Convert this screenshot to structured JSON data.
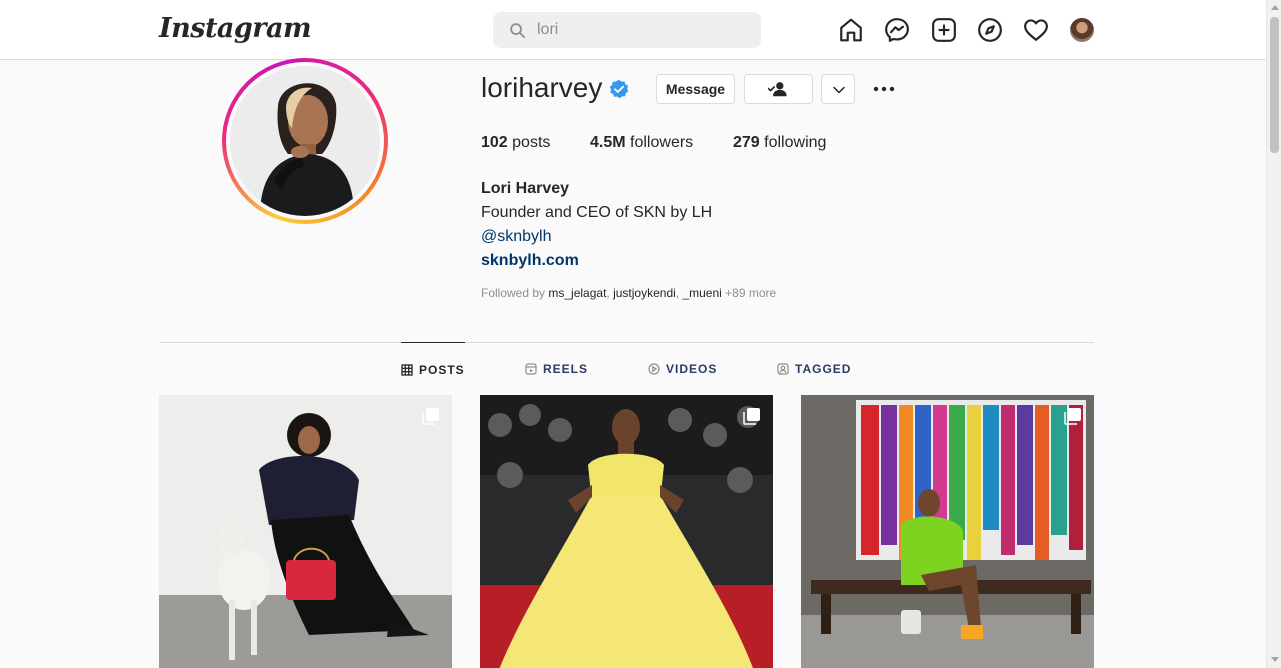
{
  "nav": {
    "logo": "Instagram",
    "search_value": "lori",
    "icons": [
      "home-icon",
      "messenger-icon",
      "new-post-icon",
      "explore-icon",
      "activity-heart-icon",
      "profile-avatar"
    ]
  },
  "profile": {
    "username": "loriharvey",
    "verified": true,
    "message_label": "Message",
    "stats": {
      "posts_count": "102",
      "posts_label": "posts",
      "followers_count": "4.5M",
      "followers_label": "followers",
      "following_count": "279",
      "following_label": "following"
    },
    "full_name": "Lori Harvey",
    "bio": "Founder and CEO of SKN by LH",
    "mention": "@sknbylh",
    "website": "sknbylh.com",
    "followed_by": {
      "prefix": "Followed by ",
      "names": [
        "ms_jelagat",
        "justjoykendi",
        "_mueni"
      ],
      "more": "+89 more"
    }
  },
  "tabs": [
    {
      "label": "POSTS",
      "icon": "grid-icon",
      "active": true
    },
    {
      "label": "REELS",
      "icon": "reels-icon",
      "active": false
    },
    {
      "label": "VIDEOS",
      "icon": "video-icon",
      "active": false
    },
    {
      "label": "TAGGED",
      "icon": "tagged-icon",
      "active": false
    }
  ],
  "posts": [
    {
      "type": "carousel"
    },
    {
      "type": "carousel"
    },
    {
      "type": "carousel"
    }
  ],
  "colors": {
    "accent_link": "#00376b",
    "verified_blue": "#3897f0",
    "text": "#262626",
    "muted": "#8e8e8e",
    "border": "#dbdbdb"
  }
}
